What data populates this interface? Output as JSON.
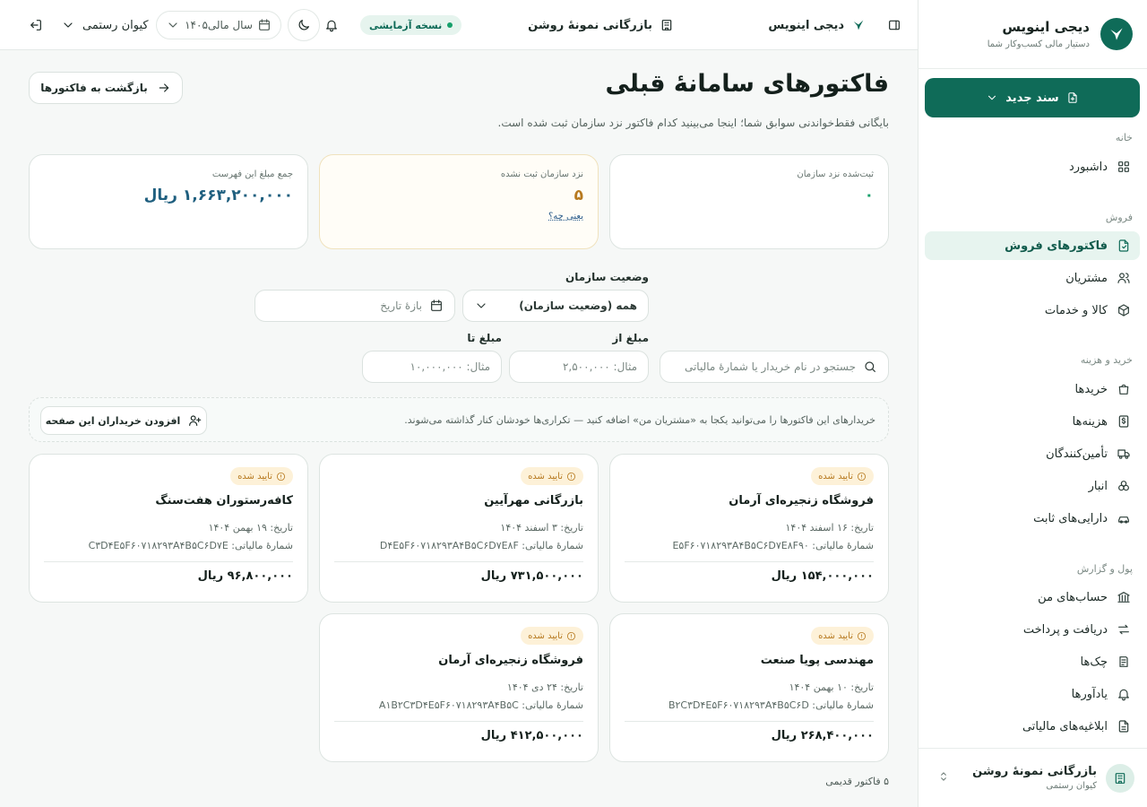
{
  "sidebar": {
    "brand_name": "دیجی اینویس",
    "brand_sub": "دستیار مالی کسب‌وکار شما",
    "new_doc_label": "سند جدید",
    "sections": {
      "home": "خانه",
      "sales": "فروش",
      "purchase": "خرید و هزینه",
      "money": "پول و گزارش"
    },
    "items": {
      "dashboard": "داشبورد",
      "sales_invoices": "فاکتورهای فروش",
      "customers": "مشتریان",
      "goods": "کالا و خدمات",
      "purchases": "خریدها",
      "expenses": "هزینه‌ها",
      "suppliers": "تأمین‌کنندگان",
      "warehouse": "انبار",
      "fixed_assets": "دارایی‌های ثابت",
      "accounts": "حساب‌های من",
      "receive_pay": "دریافت و پرداخت",
      "cheques": "چک‌ها",
      "reminders": "یادآورها",
      "tax_notices": "ابلاغیه‌های مالیاتی"
    },
    "org_name": "بازرگانی نمونهٔ روشن",
    "org_user": "کیوان رستمی"
  },
  "topbar": {
    "app_name": "دیجی اینویس",
    "company": "بازرگانی نمونهٔ روشن",
    "trial_label": "نسخه آزمایشی",
    "fiscal_year": "سال مالی۱۴۰۵",
    "user_name": "کیوان رستمی"
  },
  "page": {
    "title": "فاکتورهای سامانهٔ قبلی",
    "subtitle": "بایگانی فقط‌خواندنی سوابق شما؛ اینجا می‌بینید کدام فاکتور نزد سازمان ثبت شده است.",
    "back_label": "بازگشت به فاکتورها"
  },
  "stats": {
    "registered_label": "ثبت‌شده نزد سازمان",
    "registered_value": "۰",
    "unregistered_label": "نزد سازمان ثبت نشده",
    "unregistered_value": "۵",
    "unregistered_link": "یعنی چه؟",
    "total_label": "جمع مبلغ این فهرست",
    "total_value": "۱,۶۶۳,۲۰۰,۰۰۰ ریال"
  },
  "filters": {
    "status_label": "وضعیت سازمان",
    "status_value": "همه (وضعیت سازمان)",
    "date_placeholder": "بازهٔ تاریخ",
    "search_placeholder": "جستجو در نام خریدار یا شمارهٔ مالیاتی",
    "amount_from_label": "مبلغ از",
    "amount_from_placeholder": "مثال: ۲,۵۰۰,۰۰۰",
    "amount_to_label": "مبلغ تا",
    "amount_to_placeholder": "مثال: ۱۰,۰۰۰,۰۰۰"
  },
  "banner": {
    "text": "خریدارهای این فاکتورها را می‌توانید یکجا به «مشتریان من» اضافه کنید — تکراری‌ها خودشان کنار گذاشته می‌شوند.",
    "button_label": "افزودن خریداران این صفحه"
  },
  "invoices": [
    {
      "status": "تایید شده",
      "buyer": "فروشگاه زنجیره‌ای آرمان",
      "date": "تاریخ: ۱۶ اسفند ۱۴۰۴",
      "tax_id": "شمارهٔ مالیاتی: E۵F۶۰۷۱۸۲۹۳A۴B۵C۶D۷E۸F۹۰",
      "amount": "۱۵۴,۰۰۰,۰۰۰ ریال"
    },
    {
      "status": "تایید شده",
      "buyer": "بازرگانی مهرآیین",
      "date": "تاریخ: ۳ اسفند ۱۴۰۴",
      "tax_id": "شمارهٔ مالیاتی: D۴E۵F۶۰۷۱۸۲۹۳A۴B۵C۶D۷E۸F",
      "amount": "۷۳۱,۵۰۰,۰۰۰ ریال"
    },
    {
      "status": "تایید شده",
      "buyer": "کافه‌رستوران هفت‌سنگ",
      "date": "تاریخ: ۱۹ بهمن ۱۴۰۴",
      "tax_id": "شمارهٔ مالیاتی: C۳D۴E۵F۶۰۷۱۸۲۹۳A۴B۵C۶D۷E",
      "amount": "۹۶,۸۰۰,۰۰۰ ریال"
    },
    {
      "status": "تایید شده",
      "buyer": "مهندسی پویا صنعت",
      "date": "تاریخ: ۱۰ بهمن ۱۴۰۴",
      "tax_id": "شمارهٔ مالیاتی: B۲C۳D۴E۵F۶۰۷۱۸۲۹۳A۴B۵C۶D",
      "amount": "۲۶۸,۴۰۰,۰۰۰ ریال"
    },
    {
      "status": "تایید شده",
      "buyer": "فروشگاه زنجیره‌ای آرمان",
      "date": "تاریخ: ۲۴ دی ۱۴۰۴",
      "tax_id": "شمارهٔ مالیاتی: A۱B۲C۳D۴E۵F۶۰۷۱۸۲۹۳A۴B۵C",
      "amount": "۴۱۲,۵۰۰,۰۰۰ ریال"
    }
  ],
  "footer": {
    "count_label": "۵ فاکتور قدیمی"
  },
  "colors": {
    "brand": "#0f6b58",
    "stat_registered": "#16a06b",
    "stat_unregistered": "#b7791f",
    "stat_total": "#1f5f7f",
    "badge_bg": "#fdf1d8",
    "badge_text": "#b7791f"
  },
  "icons": {
    "brand": "bird-logo-icon",
    "new_doc": "file-plus-icon",
    "back": "arrow-right-icon",
    "calendar": "calendar-icon",
    "search": "search-icon",
    "badge": "info-circle-icon"
  }
}
